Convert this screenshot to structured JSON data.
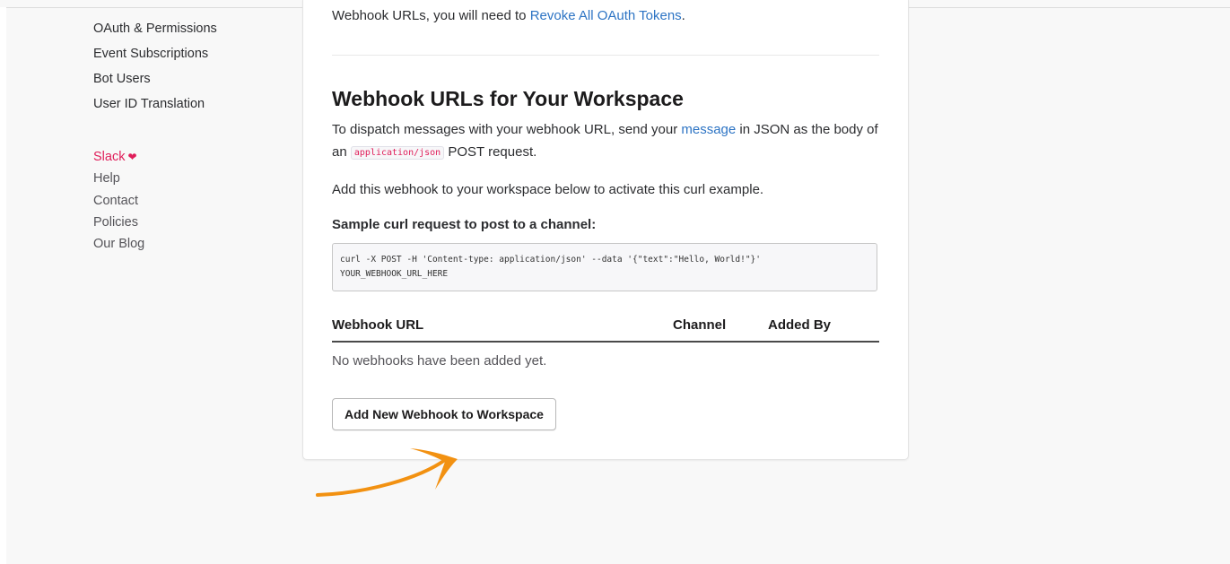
{
  "sidebar": {
    "nav_items": [
      {
        "label": "OAuth & Permissions"
      },
      {
        "label": "Event Subscriptions"
      },
      {
        "label": "Bot Users"
      },
      {
        "label": "User ID Translation"
      }
    ],
    "footer": {
      "slack": "Slack",
      "help": "Help",
      "contact": "Contact",
      "policies": "Policies",
      "blog": "Our Blog"
    }
  },
  "main": {
    "intro_text": "Webhook URLs, you will need to",
    "intro_link": "Revoke All OAuth Tokens",
    "intro_end": ".",
    "heading": "Webhook URLs for Your Workspace",
    "para1_a": "To dispatch messages with your webhook URL, send your",
    "para1_link": "message",
    "para1_b": "in JSON as the body of an",
    "para1_code": "application/json",
    "para1_c": "POST request.",
    "para2": "Add this webhook to your workspace below to activate this curl example.",
    "curl_label": "Sample curl request to post to a channel:",
    "curl_code": "curl -X POST -H 'Content-type: application/json' --data '{\"text\":\"Hello, World!\"}' YOUR_WEBHOOK_URL_HERE",
    "table": {
      "headers": [
        "Webhook URL",
        "Channel",
        "Added By"
      ],
      "empty": "No webhooks have been added yet."
    },
    "add_button": "Add New Webhook to Workspace"
  },
  "colors": {
    "link": "#2d74c4",
    "slack_pink": "#e01e5a",
    "arrow_orange": "#f29111"
  },
  "icons": {
    "heart": "heart-icon",
    "annotation_arrow": "arrow-annotation"
  }
}
